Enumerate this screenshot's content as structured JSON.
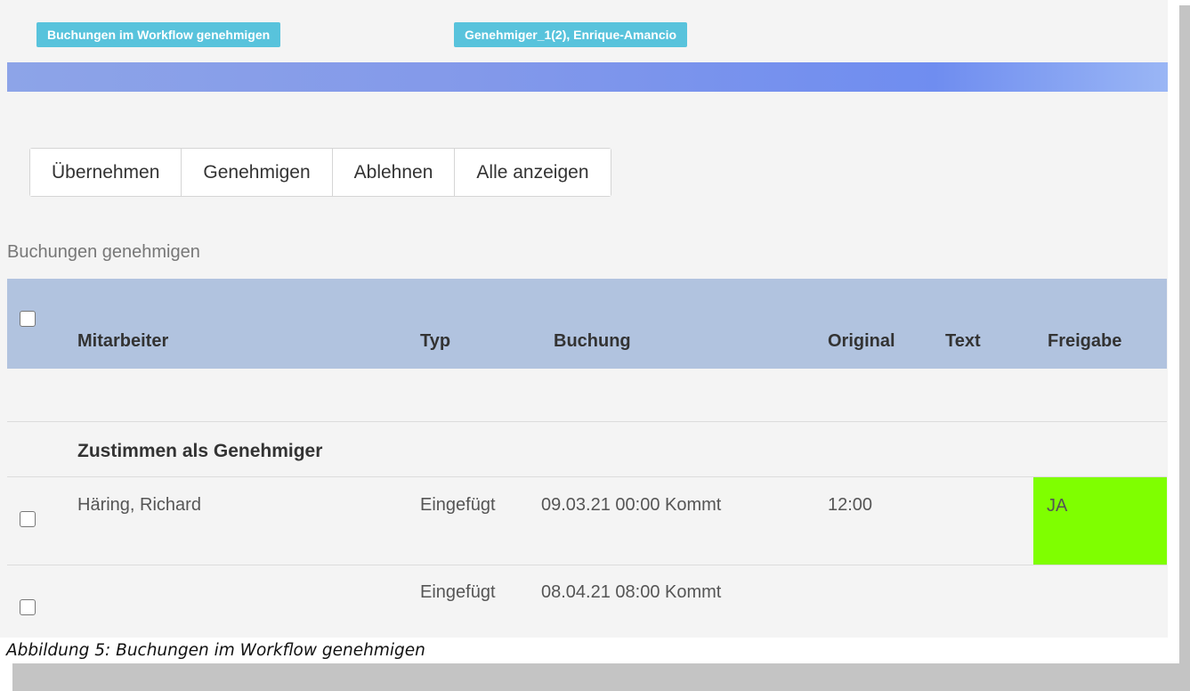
{
  "header": {
    "tag_workflow": "Buchungen im Workflow genehmigen",
    "tag_approver": "Genehmiger_1(2), Enrique-Amancio"
  },
  "toolbar": {
    "buttons": [
      "Übernehmen",
      "Genehmigen",
      "Ablehnen",
      "Alle anzeigen"
    ]
  },
  "section": {
    "title": "Buchungen genehmigen"
  },
  "table": {
    "columns": [
      "Mitarbeiter",
      "Typ",
      "Buchung",
      "Original",
      "Text",
      "Freigabe"
    ],
    "group_label": "Zustimmen als Genehmiger",
    "rows": [
      {
        "mitarbeiter": "Häring, Richard",
        "typ": "Eingefügt",
        "buchung": "09.03.21 00:00 Kommt",
        "original": "12:00",
        "text": "",
        "freigabe": "JA"
      },
      {
        "mitarbeiter": "",
        "typ": "Eingefügt",
        "buchung": "08.04.21 08:00 Kommt",
        "original": "",
        "text": "",
        "freigabe": ""
      }
    ]
  },
  "caption": "Abbildung 5: Buchungen im Workflow genehmigen",
  "colors": {
    "tag_bg": "#58c3dc",
    "header_bg": "#b1c3df",
    "approved_bg": "#7fff00",
    "banner": "#7f97ec"
  }
}
